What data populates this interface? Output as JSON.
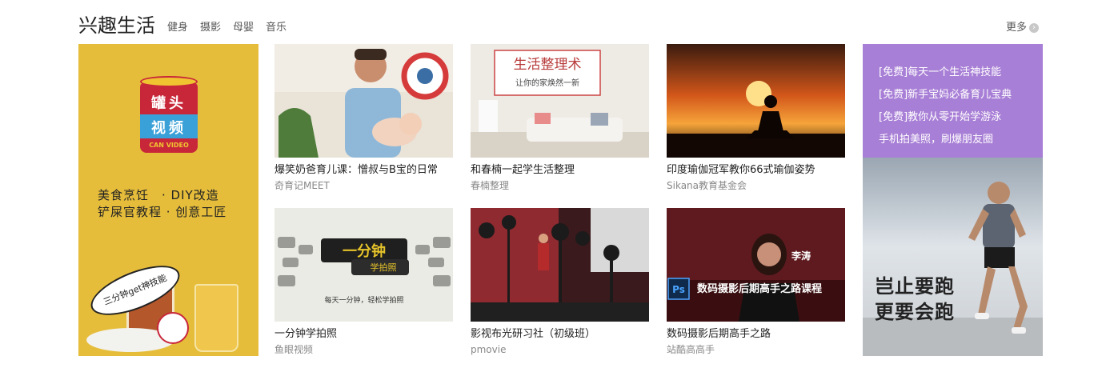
{
  "header": {
    "title": "兴趣生活",
    "tabs": [
      "健身",
      "摄影",
      "母婴",
      "音乐"
    ],
    "more_label": "更多"
  },
  "left_banner": {
    "can_label_line1": "罐头",
    "can_label_line2": "视频",
    "can_label_line3": "CAN VIDEO",
    "line1": "美食烹饪　· DIY改造",
    "line2": "铲屎官教程 · 创意工匠",
    "bubble_text": "三分钟get神技能"
  },
  "cards": [
    {
      "title": "爆笑奶爸育儿课：憎叔与B宝的日常",
      "author": "奇育记MEET",
      "thumb_overlay": ""
    },
    {
      "title": "和春楠一起学生活整理",
      "author": "春楠整理",
      "thumb_overlay": "生活整理术",
      "thumb_sub": "让你的家焕然一新"
    },
    {
      "title": "印度瑜伽冠军教你66式瑜伽姿势",
      "author": "Sikana教育基金会",
      "thumb_overlay": ""
    },
    {
      "title": "一分钟学拍照",
      "author": "鱼眼视频",
      "thumb_overlay": "一分钟",
      "thumb_sub": "学拍照",
      "thumb_sub2": "每天一分钟，轻松学拍照"
    },
    {
      "title": "影视布光研习社（初级班）",
      "author": "pmovie",
      "thumb_overlay": ""
    },
    {
      "title": "数码摄影后期高手之路",
      "author": "站酷高高手",
      "thumb_overlay": "数码摄影后期高手之路课程",
      "thumb_sub": "李涛",
      "thumb_icon": "Ps"
    }
  ],
  "right_banner": {
    "promos": [
      "[免费]每天一个生活神技能",
      "[免费]新手宝妈必备育儿宝典",
      "[免费]教你从零开始学游泳",
      "手机拍美照，刷爆朋友圈"
    ],
    "slogan_line1": "岂止要跑",
    "slogan_line2": "更要会跑"
  }
}
